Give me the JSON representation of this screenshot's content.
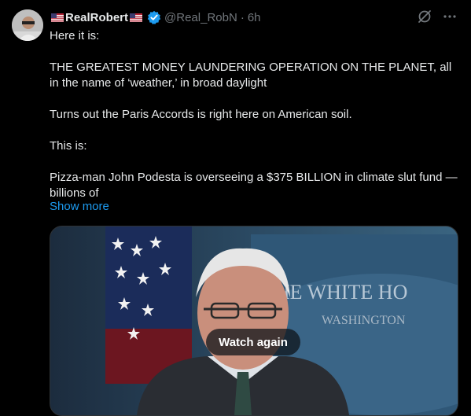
{
  "tweet": {
    "display_name": "RealRobert",
    "handle": "@Real_RobN",
    "separator": "·",
    "time": "6h",
    "paragraphs": [
      "Here it is:",
      "THE GREATEST MONEY LAUNDERING OPERATION ON THE PLANET, all in the name of ‘weather,’ in broad daylight",
      "Turns out the Paris Accords is right here on American soil.",
      "This is:",
      "Pizza-man John Podesta is overseeing a $375 BILLION in climate slut fund — billions of"
    ],
    "show_more": "Show more"
  },
  "media": {
    "sign_line1": "THE WHITE HO",
    "sign_line2": "WASHINGTON",
    "watch_again": "Watch again"
  },
  "icons": {
    "verified": "verified-badge-icon",
    "grok": "grok-icon",
    "more": "more-options-icon",
    "flag": "us-flag-icon"
  },
  "colors": {
    "link": "#1d9bf0",
    "verified": "#1d9bf0",
    "muted": "#71767b"
  }
}
